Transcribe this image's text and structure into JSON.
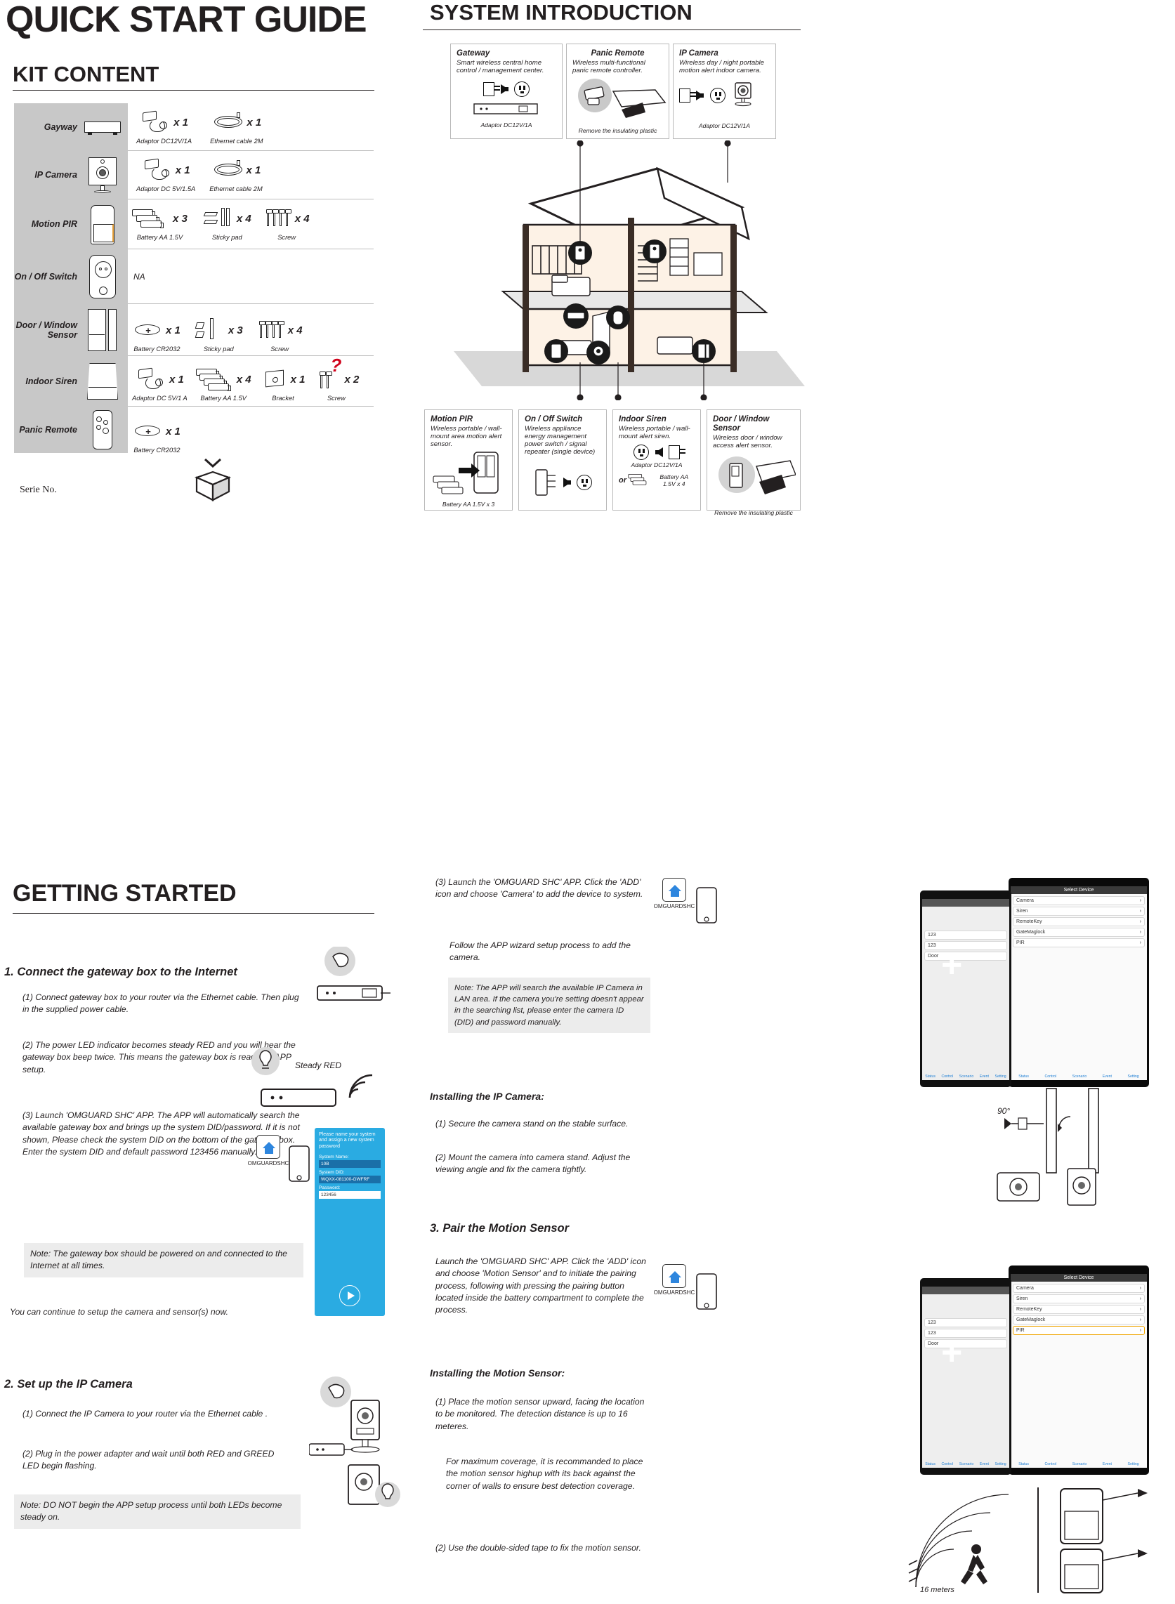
{
  "doc": {
    "title": "QUICK START GUIDE",
    "kit_content_heading": "KIT CONTENT",
    "system_intro_heading": "SYSTEM  INTRODUCTION",
    "getting_started_heading": "GETTING STARTED",
    "serie_no": "Serie No."
  },
  "kit": {
    "rows": [
      {
        "device": "Gayway",
        "device_icon": "gateway-box",
        "accessories": [
          {
            "label": "Adaptor DC12V/1A",
            "qty": "x 1",
            "icon": "power-adaptor-icon"
          },
          {
            "label": "Ethernet cable 2M",
            "qty": "x 1",
            "icon": "ethernet-cable-icon"
          }
        ]
      },
      {
        "device": "IP Camera",
        "device_icon": "ip-camera",
        "accessories": [
          {
            "label": "Adaptor DC 5V/1.5A",
            "qty": "x 1",
            "icon": "power-adaptor-icon"
          },
          {
            "label": "Ethernet cable 2M",
            "qty": "x 1",
            "icon": "ethernet-cable-icon"
          }
        ]
      },
      {
        "device": "Motion PIR",
        "device_icon": "motion-pir",
        "accessories": [
          {
            "label": "Battery AA 1.5V",
            "qty": "x 3",
            "icon": "aa-battery-icon"
          },
          {
            "label": "Sticky pad",
            "qty": "x 4",
            "icon": "sticky-pad-icon"
          },
          {
            "label": "Screw",
            "qty": "x 4",
            "icon": "screw-icon"
          }
        ]
      },
      {
        "device": "On / Off Switch",
        "device_icon": "on-off-switch",
        "na_text": "NA",
        "accessories": []
      },
      {
        "device": "Door / Window Sensor",
        "device_icon": "door-window-sensor",
        "accessories": [
          {
            "label": "Battery  CR2032",
            "qty": "x 1",
            "icon": "coin-battery-icon"
          },
          {
            "label": "Sticky pad",
            "qty": "x 3",
            "icon": "sticky-pad-icon"
          },
          {
            "label": "Screw",
            "qty": "x 4",
            "icon": "screw-icon"
          }
        ]
      },
      {
        "device": "Indoor Siren",
        "device_icon": "indoor-siren",
        "accessories": [
          {
            "label": "Adaptor DC 5V/1 A",
            "qty": "x 1",
            "icon": "power-adaptor-icon"
          },
          {
            "label": "Battery  AA 1.5V",
            "qty": "x 4",
            "icon": "aa-battery-icon"
          },
          {
            "label": "Bracket",
            "qty": "x 1",
            "icon": "bracket-icon"
          },
          {
            "label": "Screw",
            "qty": "x 2",
            "icon": "screw-icon",
            "marker": "?"
          }
        ]
      },
      {
        "device": "Panic Remote",
        "device_icon": "panic-remote",
        "accessories": [
          {
            "label": "Battery  CR2032",
            "qty": "x 1",
            "icon": "coin-battery-icon"
          }
        ]
      }
    ]
  },
  "system_intro": {
    "top_panels": [
      {
        "title": "Gateway",
        "desc": "Smart wireless central home control / management center.",
        "caption": "Adaptor DC12V/1A"
      },
      {
        "title": "Panic Remote",
        "desc": "Wireless multi-functional panic remote controller.",
        "caption": "Remove the insulating plastic"
      },
      {
        "title": "IP Camera",
        "desc": "Wireless day / night portable motion alert indoor camera.",
        "caption": "Adaptor DC12V/1A"
      }
    ],
    "bottom_panels": [
      {
        "title": "Motion PIR",
        "desc": "Wireless portable  / wall-mount area motion alert sensor.",
        "caption": "Battery AA 1.5V x 3"
      },
      {
        "title": "On / Off Switch",
        "desc": "Wireless appliance energy management power switch / signal repeater (single device)",
        "caption": ""
      },
      {
        "title": "Indoor Siren",
        "desc": "Wireless portable / wall-mount alert siren.",
        "caption": "Adaptor DC12V/1A",
        "caption2_prefix": "or",
        "caption2": "Battery  AA 1.5V x 4"
      },
      {
        "title": "Door / Window Sensor",
        "desc": "Wireless door / window access alert sensor.",
        "caption": "Remove the insulating plastic"
      }
    ]
  },
  "getting_started": {
    "step1": {
      "heading": "1. Connect the gateway box to the Internet",
      "items": [
        "(1) Connect gateway box to your router via the Ethernet cable. Then plug in the supplied power cable.",
        "(2) The power LED indicator becomes steady RED and you will hear the gateway box beep twice. This means the gateway box is ready for APP setup.",
        "(3) Launch 'OMGUARD SHC' APP. The APP will automatically search the available gateway box and brings up the system DID/password. If it is not shown,  Please check the system DID on the bottom of the gateway box. Enter the system DID and default password 123456 manually."
      ],
      "note": "Note:  The gateway box should be powered on and connected to the Internet at all times.",
      "closing": "You can continue to setup the camera and sensor(s) now.",
      "led_label": "Steady RED",
      "app_label": "OMGUARDSHC",
      "phone_form": {
        "header": "Please name your system and assign a new system password",
        "fields": [
          {
            "label": "System Name:",
            "value": "10B"
          },
          {
            "label": "System DID:",
            "value": "WQXX-081100-GWFRF"
          },
          {
            "label": "Password:",
            "value": "123456"
          }
        ]
      }
    },
    "step2": {
      "heading": "2. Set up the IP Camera",
      "items": [
        "(1) Connect the IP Camera to your router via the Ethernet cable .",
        "(2) Plug in the power adapter and wait until both RED and GREED LED begin flashing."
      ],
      "note": "Note:  DO NOT begin the APP setup process until both LEDs become steady on."
    },
    "step2b": {
      "items": [
        "(3) Launch the 'OMGUARD SHC' APP. Click the 'ADD' icon      and choose 'Camera' to add the device to system.",
        "Follow the APP wizard setup process to add the camera."
      ],
      "note": "Note:  The APP will search the available IP Camera in LAN area. If the camera you're setting doesn't appear in the searching list, please enter the camera ID (DID) and password manually.",
      "install_heading": "Installing the IP Camera:",
      "install_items": [
        "(1) Secure the camera stand on the stable surface.",
        "(2) Mount the camera into camera stand.  Adjust the viewing angle and fix the camera tightly."
      ],
      "angle_label": "90°",
      "app_label": "OMGUARDSHC"
    },
    "step3": {
      "heading": "3. Pair the Motion Sensor",
      "body": "Launch the 'OMGUARD SHC' APP. Click the 'ADD'  icon      and choose 'Motion Sensor' and      to initiate the pairing process, following with pressing the pairing button located inside the battery compartment to complete the process.",
      "install_heading": "Installing the Motion Sensor:",
      "install_items": [
        "(1) Place the motion sensor upward, facing the location to be monitored.  The detection distance is up to 16 meteres.",
        "For maximum coverage, it is recommanded to place the motion sensor highup with its back against the corner of walls to ensure best detection coverage.",
        "(2) Use the double-sided tape to fix the motion sensor."
      ],
      "range_label": "16 meters",
      "app_label": "OMGUARDSHC"
    },
    "phone_select": {
      "title": "Select Device",
      "rows": [
        "Camera",
        "Siren",
        "RemoteKey",
        "GateMaglock",
        "PIR"
      ],
      "tabs": [
        "Status",
        "Control",
        "Scenario",
        "Event",
        "Setting"
      ]
    }
  },
  "colors": {
    "ink": "#231f20",
    "kit_gray": "#c8c8c8",
    "note_gray": "#ececec",
    "accent_blue": "#29b6f6",
    "marker_red": "#d0021b",
    "pir_orange": "#e8a33d"
  }
}
